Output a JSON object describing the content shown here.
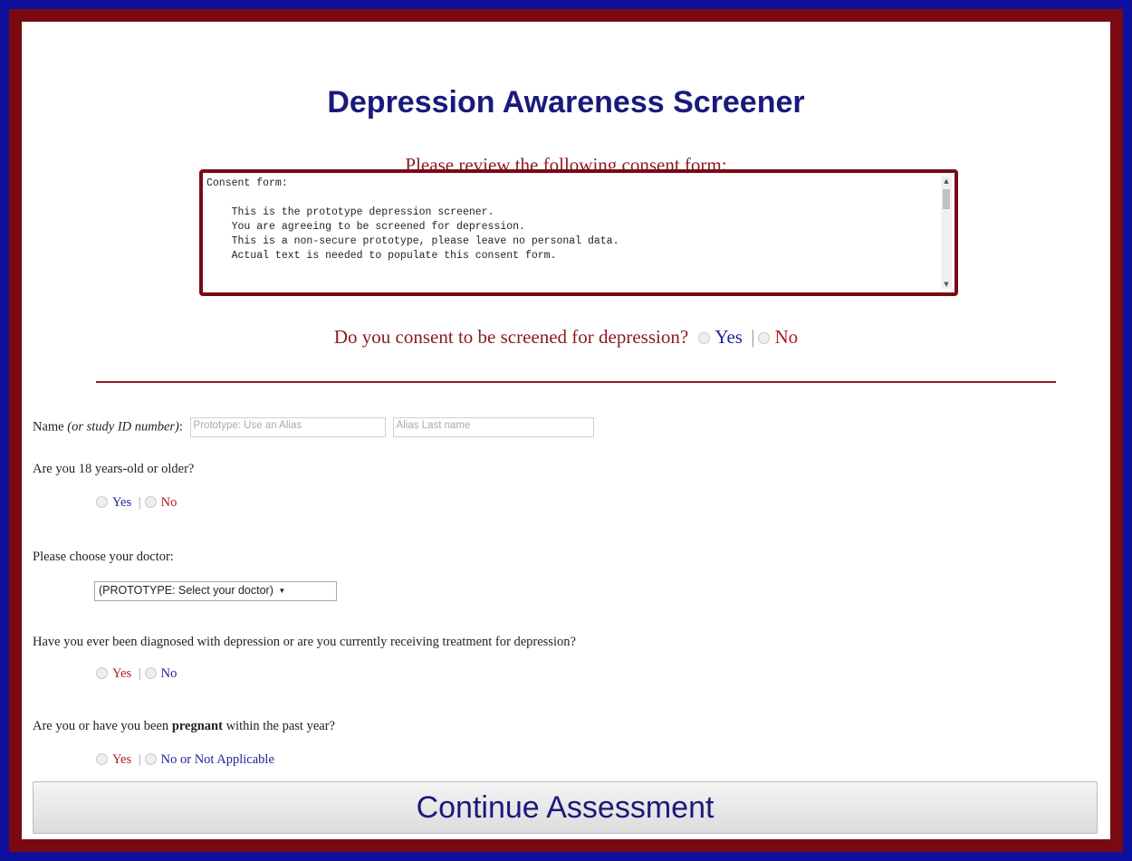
{
  "page": {
    "title": "Depression Awareness Screener",
    "review_prompt": "Please review the following consent form:"
  },
  "consent_form": {
    "text": "Consent form:\n\n    This is the prototype depression screener.\n    You are agreeing to be screened for depression.\n    This is a non-secure prototype, please leave no personal data.\n    Actual text is needed to populate this consent form."
  },
  "consent_question": {
    "label": "Do you consent to be screened for depression?",
    "yes": "Yes",
    "separator": "|",
    "no": "No"
  },
  "name_field": {
    "label": "Name",
    "hint": "(or study ID number)",
    "suffix": ":",
    "first_placeholder": "Prototype: Use an Alias",
    "last_placeholder": "Alias Last name"
  },
  "age_question": {
    "label": "Are you 18 years-old or older?",
    "yes": "Yes",
    "separator": "|",
    "no": "No"
  },
  "doctor_question": {
    "label": "Please choose your doctor:",
    "selected": "(PROTOTYPE: Select your doctor)"
  },
  "diagnosis_question": {
    "label": "Have you ever been diagnosed with depression or are you currently receiving treatment for depression?",
    "yes": "Yes",
    "separator": "|",
    "no": "No"
  },
  "pregnancy_question": {
    "label_before": "Are you or have you been ",
    "label_bold": "pregnant",
    "label_after": " within the past year?",
    "yes": "Yes",
    "separator": "|",
    "no": "No or Not Applicable"
  },
  "continue_button": {
    "label": "Continue Assessment"
  },
  "colors": {
    "outer_border": "#0f0f9e",
    "inner_border": "#7a0a12",
    "title": "#1a1a7c",
    "accent_red": "#8b1c24"
  }
}
